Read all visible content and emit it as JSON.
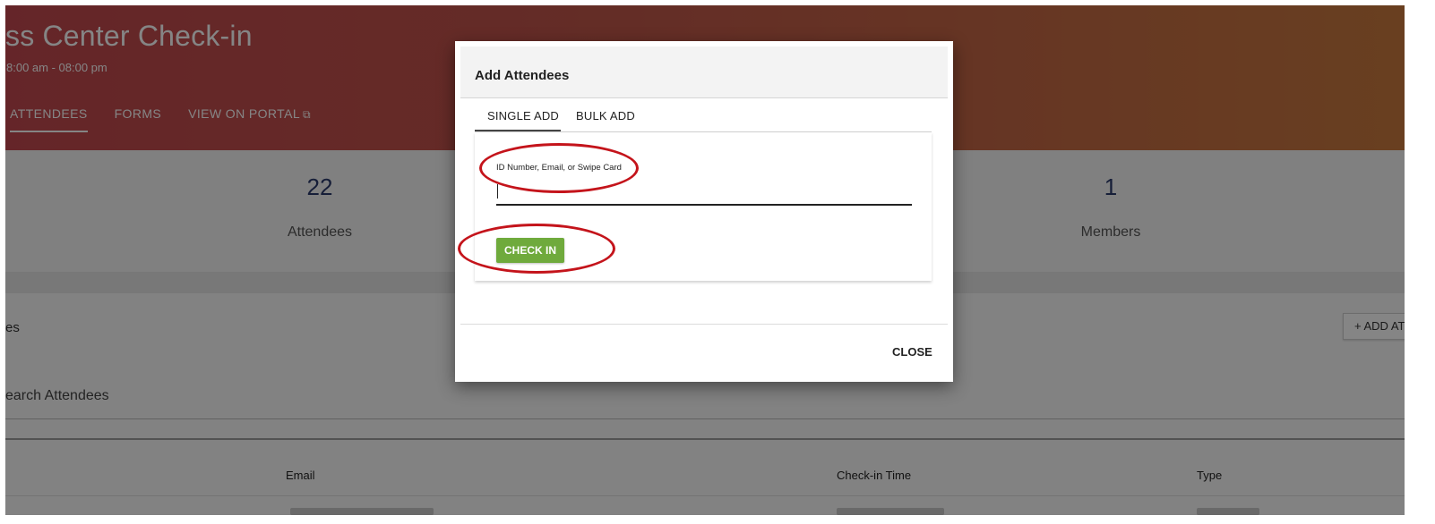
{
  "banner": {
    "title": "ss Center Check-in",
    "hours": "8:00 am - 08:00 pm",
    "tabs": [
      {
        "label": "ATTENDEES",
        "active": true
      },
      {
        "label": "FORMS",
        "active": false
      },
      {
        "label": "VIEW ON PORTAL",
        "active": false,
        "icon": "external-link-icon",
        "icon_glyph": "⧉"
      }
    ],
    "gradient": [
      "#c2484f",
      "#c97a3f"
    ]
  },
  "stats": [
    {
      "value": "22",
      "label": "Attendees"
    },
    {
      "value": "1",
      "label": "Members"
    }
  ],
  "section": {
    "title": "es",
    "add_button": "+ ADD AT",
    "search_placeholder": "earch Attendees",
    "table_headers": [
      "Email",
      "Check-in Time",
      "Type"
    ]
  },
  "modal": {
    "title": "Add Attendees",
    "tabs": [
      {
        "label": "SINGLE ADD",
        "active": true
      },
      {
        "label": "BULK ADD",
        "active": false
      }
    ],
    "field_label": "ID Number, Email, or Swipe Card",
    "field_value": "",
    "check_in_label": "CHECK IN",
    "close_label": "CLOSE"
  },
  "colors": {
    "primary_accent": "#2b3a6b",
    "check_in_button": "#6faa3c",
    "annotation": "#c4141b"
  }
}
